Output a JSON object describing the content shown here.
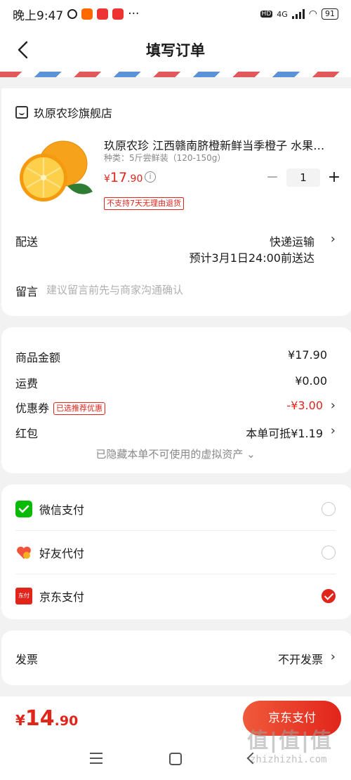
{
  "status_bar": {
    "time": "晚上9:47",
    "network": "4G",
    "battery": "91"
  },
  "nav": {
    "title": "填写订单"
  },
  "shop": {
    "name": "玖原农珍旗舰店"
  },
  "product": {
    "title": "玖原农珍 江西赣南脐橙新鲜当季橙子 水果京东自营",
    "spec": "种类：5斤尝鲜装（120-150g）",
    "price_currency": "¥",
    "price_int": "17",
    "price_dec": ".90",
    "return_policy": "不支持7天无理由退货",
    "quantity": "1",
    "minus": "−",
    "plus": "+"
  },
  "delivery": {
    "label": "配送",
    "method": "快递运输",
    "eta": "预计3月1日24:00前送达"
  },
  "message": {
    "label": "留言",
    "placeholder": "建议留言前先与商家沟通确认"
  },
  "prices": {
    "goods_label": "商品金额",
    "goods_value": "¥17.90",
    "shipping_label": "运费",
    "shipping_value": "¥0.00",
    "coupon_label": "优惠券",
    "coupon_badge": "已选推荐优惠",
    "coupon_value": "-¥3.00",
    "redpacket_label": "红包",
    "redpacket_value": "本单可抵¥1.19",
    "hidden_note": "已隐藏本单不可使用的虚拟资产 ⌄"
  },
  "payment": {
    "options": [
      {
        "label": "微信支付",
        "selected": false
      },
      {
        "label": "好友代付",
        "selected": false
      },
      {
        "label": "京东支付",
        "selected": true
      }
    ],
    "jd_logo_text": "东付"
  },
  "invoice": {
    "label": "发票",
    "value": "不开发票"
  },
  "footer": {
    "currency": "¥",
    "total_int": "14",
    "total_dec": ".90",
    "pay_button": "京东支付"
  },
  "watermark": {
    "main": "值|值|值",
    "sub": "zhizhizhi.com"
  },
  "colors": {
    "accent": "#e1251b",
    "wechat": "#09bb07"
  }
}
